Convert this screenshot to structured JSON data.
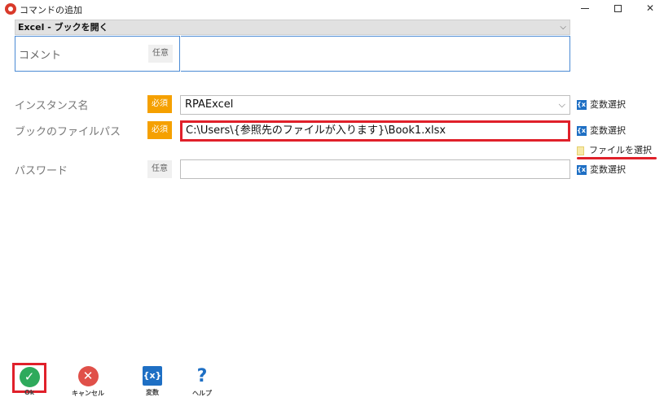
{
  "window": {
    "title": "コマンドの追加",
    "minimize": "",
    "maximize": "",
    "close": "✕"
  },
  "command_select": {
    "value": "Excel - ブックを開く",
    "chevron": "⌵"
  },
  "comment": {
    "label": "コメント",
    "badge": "任意",
    "value": ""
  },
  "fields": {
    "instance": {
      "label": "インスタンス名",
      "badge": "必須",
      "value": "RPAExcel",
      "chevron": "⌵",
      "var_link": "変数選択"
    },
    "file_path": {
      "label": "ブックのファイルパス",
      "badge": "必須",
      "value": "C:\\Users\\{参照先のファイルが入ります}\\Book1.xlsx",
      "var_link": "変数選択",
      "file_link": "ファイルを選択"
    },
    "password": {
      "label": "パスワード",
      "badge": "任意",
      "value": "",
      "var_link": "変数選択"
    }
  },
  "icons": {
    "var_icon": "{x}"
  },
  "toolbar": {
    "ok": {
      "label": "Ok",
      "glyph": "✓"
    },
    "cancel": {
      "label": "キャンセル",
      "glyph": "✕"
    },
    "variable": {
      "label": "変数",
      "glyph": "{x}"
    },
    "help": {
      "label": "ヘルプ",
      "glyph": "?"
    }
  },
  "colors": {
    "required_badge": "#f5a000",
    "highlight": "#e0202a",
    "accent_blue": "#1e6fc4",
    "ok_green": "#2eaa5c",
    "cancel_red": "#e05049"
  }
}
